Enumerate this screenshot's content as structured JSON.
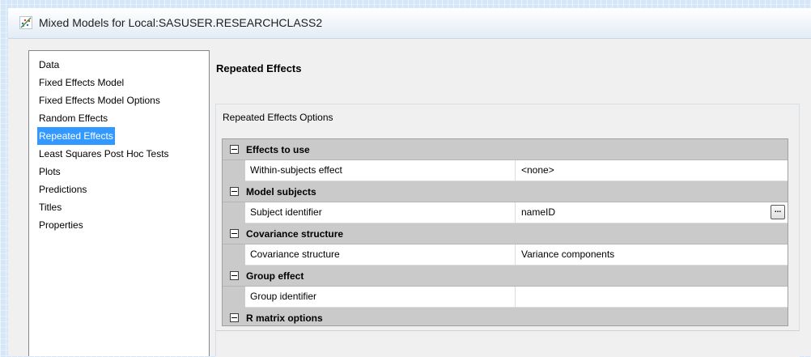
{
  "window": {
    "title": "Mixed Models for Local:SASUSER.RESEARCHCLASS2",
    "icon": "mixed-models-icon"
  },
  "nav": {
    "items": [
      {
        "label": "Data"
      },
      {
        "label": "Fixed Effects Model"
      },
      {
        "label": "Fixed Effects Model Options"
      },
      {
        "label": "Random Effects"
      },
      {
        "label": "Repeated Effects",
        "selected": true
      },
      {
        "label": "Least Squares Post Hoc Tests"
      },
      {
        "label": "Plots"
      },
      {
        "label": "Predictions"
      },
      {
        "label": "Titles"
      },
      {
        "label": "Properties"
      }
    ],
    "selected_color": "#3399ff"
  },
  "panel": {
    "title": "Repeated Effects",
    "group_title": "Repeated Effects Options"
  },
  "grid": {
    "categories": [
      {
        "label": "Effects to use",
        "props": [
          {
            "name": "Within-subjects effect",
            "value": "<none>"
          }
        ]
      },
      {
        "label": "Model subjects",
        "props": [
          {
            "name": "Subject identifier",
            "value": "nameID",
            "button": "..."
          }
        ]
      },
      {
        "label": "Covariance structure",
        "props": [
          {
            "name": "Covariance structure",
            "value": "Variance components"
          }
        ]
      },
      {
        "label": "Group effect",
        "props": [
          {
            "name": "Group identifier",
            "value": ""
          }
        ]
      },
      {
        "label": "R matrix options",
        "props": []
      }
    ],
    "category_bg": "#cacaca"
  }
}
